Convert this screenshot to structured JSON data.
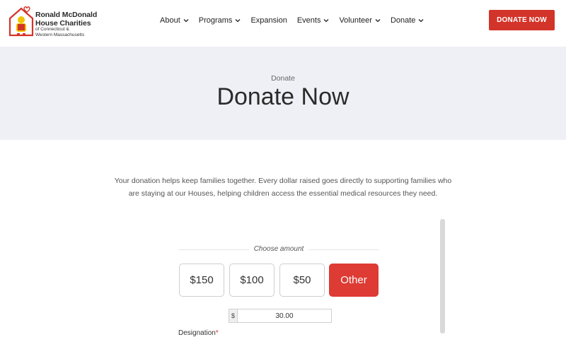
{
  "header": {
    "logo": {
      "line1": "Ronald McDonald",
      "line2": "House Charities",
      "line3": "of Connecticut &",
      "line4": "Western Massachusetts"
    },
    "nav": [
      {
        "label": "About",
        "has_dropdown": true
      },
      {
        "label": "Programs",
        "has_dropdown": true
      },
      {
        "label": "Expansion",
        "has_dropdown": false
      },
      {
        "label": "Events",
        "has_dropdown": true
      },
      {
        "label": "Volunteer",
        "has_dropdown": true
      },
      {
        "label": "Donate",
        "has_dropdown": true
      }
    ],
    "donate_button": "DONATE NOW"
  },
  "hero": {
    "breadcrumb": "Donate",
    "title": "Donate Now"
  },
  "intro": "Your donation helps keep families together. Every dollar raised goes directly to supporting families who are staying at our Houses, helping children access the essential medical resources they need.",
  "form": {
    "choose_label": "Choose amount",
    "amounts": [
      "$150",
      "$100",
      "$50",
      "Other"
    ],
    "selected": "Other",
    "currency_symbol": "$",
    "custom_amount_value": "30.00",
    "designation_label": "Designation"
  },
  "colors": {
    "brand_red": "#d3342a",
    "hero_bg": "#eef0f5"
  }
}
